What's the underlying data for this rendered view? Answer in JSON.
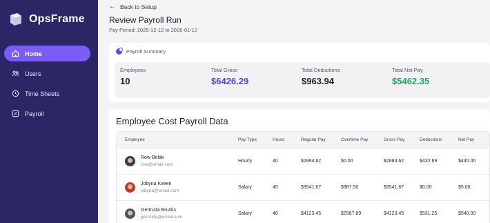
{
  "app": {
    "name": "OpsFrame"
  },
  "sidebar": {
    "items": [
      {
        "label": "Home",
        "icon": "home-icon",
        "active": true
      },
      {
        "label": "Users",
        "icon": "users-icon",
        "active": false
      },
      {
        "label": "Time Sheets",
        "icon": "clock-icon",
        "active": false
      },
      {
        "label": "Payroll",
        "icon": "payroll-icon",
        "active": false
      }
    ]
  },
  "header": {
    "back_label": "Back to Setup",
    "title": "Review Payroll Run",
    "pay_period": "Pay Period: 2025-12-12 to 2026-01-12"
  },
  "summary": {
    "heading": "Payroll Summary",
    "stats": [
      {
        "label": "Employees",
        "value": "10",
        "color": "#1f1f24"
      },
      {
        "label": "Total Gross",
        "value": "$6426.29",
        "color": "#5b3fe0"
      },
      {
        "label": "Total Deductions",
        "value": "$963.94",
        "color": "#1f1f24"
      },
      {
        "label": "Total Net Pay",
        "value": "$5462.35",
        "color": "#1fa36b"
      }
    ]
  },
  "table": {
    "title": "Employee Cost Payroll Data",
    "columns": [
      "Employee",
      "Pay Type",
      "Hours",
      "Regular Pay",
      "Overtime Pay",
      "Gross Pay",
      "Deductions",
      "Net Pay"
    ],
    "rows": [
      {
        "name": "Row Belak",
        "email": "row@email.com",
        "pay_type": "Hourly",
        "hours": "40",
        "regular": "$2884.62",
        "overtime": "$0.00",
        "gross": "$2884.62",
        "deductions": "$432.69",
        "net": "$440.00"
      },
      {
        "name": "Jobyna Kveen",
        "email": "jobyna@email.com",
        "pay_type": "Salary",
        "hours": "45",
        "regular": "$3541.67",
        "overtime": "$987.50",
        "gross": "$3541.67",
        "deductions": "$0.00",
        "net": "$5.00"
      },
      {
        "name": "Gertruda Brucks",
        "email": "gertruda@email.com",
        "pay_type": "Salary",
        "hours": "48",
        "regular": "$4123.45",
        "overtime": "$2567.89",
        "gross": "$4123.45",
        "deductions": "$531.25",
        "net": "$540.00"
      }
    ]
  },
  "colors": {
    "sidebar": "#2c2566",
    "accent": "#7b5cf5",
    "gross": "#5b3fe0",
    "net": "#1fa36b"
  }
}
